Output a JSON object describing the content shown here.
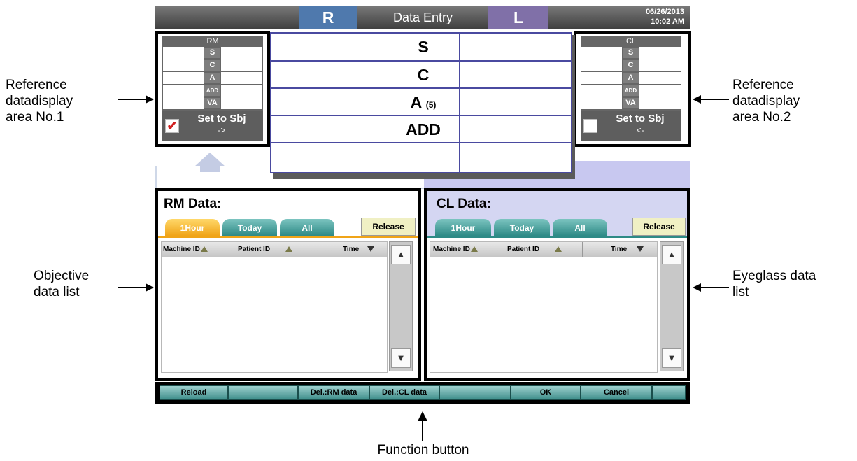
{
  "header": {
    "r_label": "R",
    "title": "Data Entry",
    "l_label": "L",
    "date": "06/26/2013",
    "time": "10:02 AM"
  },
  "reference_left": {
    "heading": "RM",
    "rows": [
      "S",
      "C",
      "A",
      "ADD",
      "VA"
    ],
    "set_to_sbj": "Set to Sbj",
    "arrow": "->",
    "checked": true
  },
  "reference_right": {
    "heading": "CL",
    "rows": [
      "S",
      "C",
      "A",
      "ADD",
      "VA"
    ],
    "set_to_sbj": "Set to Sbj",
    "arrow": "<-",
    "checked": false
  },
  "center_grid": {
    "rows": [
      "S",
      "C",
      "A",
      "ADD",
      ""
    ],
    "a_suffix": "(5)"
  },
  "rm_panel": {
    "title": "RM Data:",
    "tabs": [
      "1Hour",
      "Today",
      "All"
    ],
    "active_tab": "1Hour",
    "release": "Release",
    "columns": [
      "Machine ID",
      "Patient ID",
      "Time"
    ]
  },
  "cl_panel": {
    "title": "CL Data:",
    "tabs": [
      "1Hour",
      "Today",
      "All"
    ],
    "release": "Release",
    "columns": [
      "Machine ID",
      "Patient ID",
      "Time"
    ]
  },
  "function_buttons": [
    "Reload",
    "",
    "Del.:RM data",
    "Del.:CL data",
    "",
    "OK",
    "Cancel",
    ""
  ],
  "callouts": {
    "ref1": [
      "Reference",
      "data display",
      "area No.1"
    ],
    "ref2": [
      "Reference",
      "data display",
      "area No.2"
    ],
    "objective": [
      "Objective",
      "data list"
    ],
    "eyeglass": [
      "Eyeglass data",
      "list"
    ],
    "function": "Function button"
  }
}
